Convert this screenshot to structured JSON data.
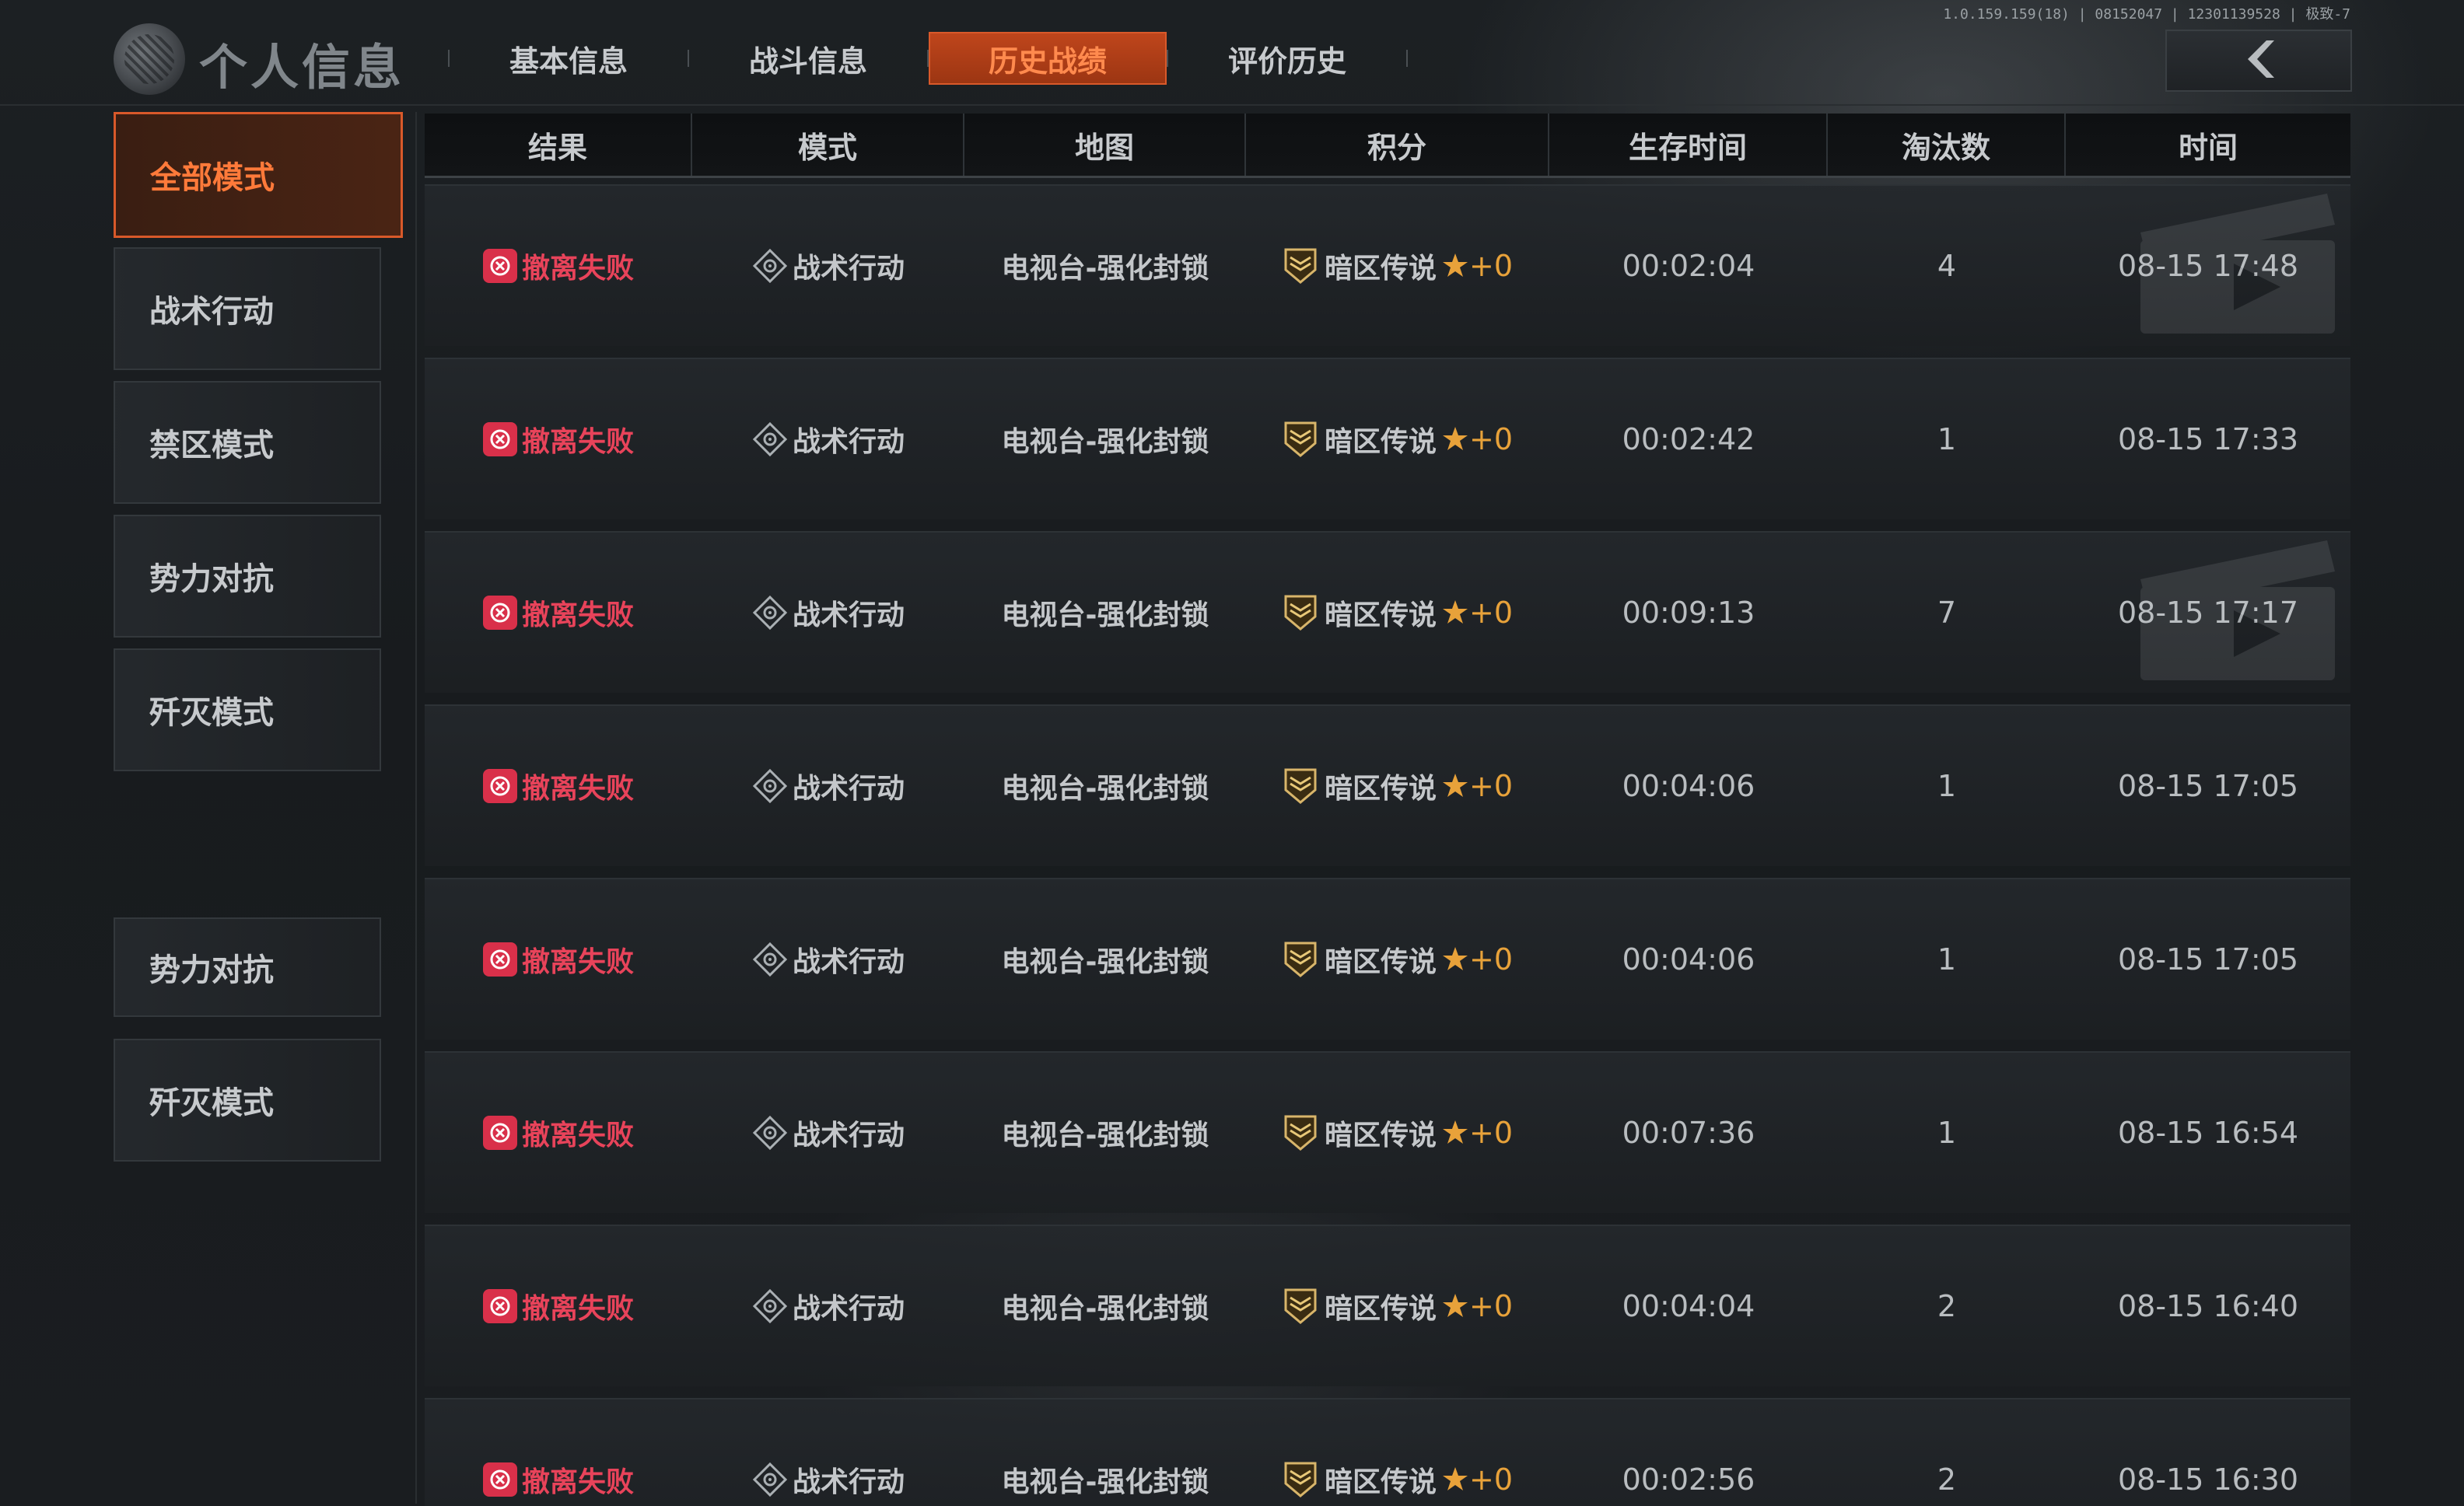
{
  "header": {
    "version": "1.0.159.159(18) | 08152047 | 12301139528 | 极致-7",
    "title": "个人信息",
    "tabs": [
      {
        "label": "基本信息"
      },
      {
        "label": "战斗信息"
      },
      {
        "label": "历史战绩",
        "active": true
      },
      {
        "label": "评价历史"
      }
    ]
  },
  "sidebar": {
    "items": [
      {
        "label": "全部模式",
        "active": true
      },
      {
        "label": "战术行动"
      },
      {
        "label": "禁区模式"
      },
      {
        "label": "势力对抗"
      },
      {
        "label": "歼灭模式"
      },
      {
        "label": "势力对抗"
      },
      {
        "label": "歼灭模式"
      }
    ]
  },
  "table": {
    "columns": [
      "结果",
      "模式",
      "地图",
      "积分",
      "生存时间",
      "淘汰数",
      "时间"
    ],
    "rows": [
      {
        "result": "撤离失败",
        "mode": "战术行动",
        "map": "电视台-强化封锁",
        "rank": "暗区传说",
        "delta": "+0",
        "survival": "00:02:04",
        "kills": "4",
        "time": "08-15 17:48"
      },
      {
        "result": "撤离失败",
        "mode": "战术行动",
        "map": "电视台-强化封锁",
        "rank": "暗区传说",
        "delta": "+0",
        "survival": "00:02:42",
        "kills": "1",
        "time": "08-15 17:33"
      },
      {
        "result": "撤离失败",
        "mode": "战术行动",
        "map": "电视台-强化封锁",
        "rank": "暗区传说",
        "delta": "+0",
        "survival": "00:09:13",
        "kills": "7",
        "time": "08-15 17:17"
      },
      {
        "result": "撤离失败",
        "mode": "战术行动",
        "map": "电视台-强化封锁",
        "rank": "暗区传说",
        "delta": "+0",
        "survival": "00:04:06",
        "kills": "1",
        "time": "08-15 17:05"
      },
      {
        "result": "撤离失败",
        "mode": "战术行动",
        "map": "电视台-强化封锁",
        "rank": "暗区传说",
        "delta": "+0",
        "survival": "00:04:06",
        "kills": "1",
        "time": "08-15 17:05"
      },
      {
        "result": "撤离失败",
        "mode": "战术行动",
        "map": "电视台-强化封锁",
        "rank": "暗区传说",
        "delta": "+0",
        "survival": "00:07:36",
        "kills": "1",
        "time": "08-15 16:54"
      },
      {
        "result": "撤离失败",
        "mode": "战术行动",
        "map": "电视台-强化封锁",
        "rank": "暗区传说",
        "delta": "+0",
        "survival": "00:04:04",
        "kills": "2",
        "time": "08-15 16:40"
      },
      {
        "result": "撤离失败",
        "mode": "战术行动",
        "map": "电视台-强化封锁",
        "rank": "暗区传说",
        "delta": "+0",
        "survival": "00:02:56",
        "kills": "2",
        "time": "08-15 16:30"
      }
    ]
  },
  "icons": {
    "logo": "globe-logo-icon",
    "back": "chevron-left-icon",
    "result": "extraction-fail-icon",
    "mode": "tactical-operation-icon",
    "rank": "legend-rank-icon",
    "star": "star-icon"
  },
  "colors": {
    "accent": "#d9592a",
    "fail": "#e8435a",
    "star": "#e8a23a"
  }
}
